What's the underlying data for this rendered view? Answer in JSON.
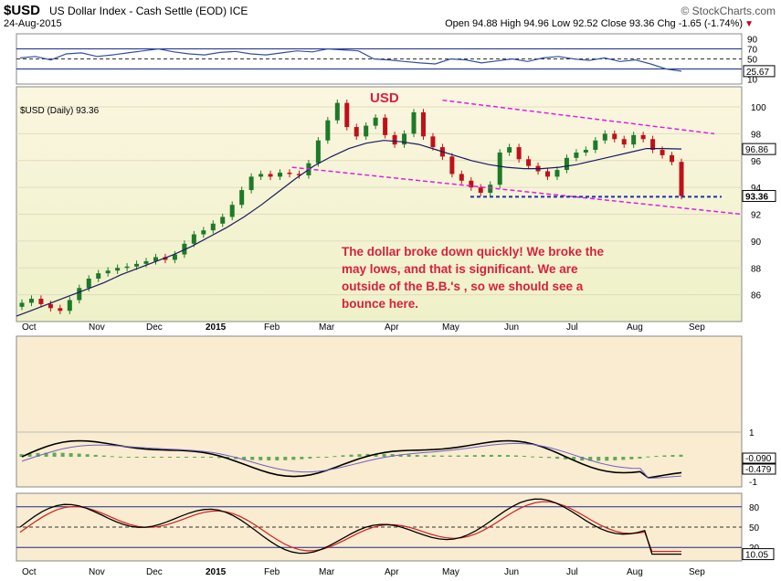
{
  "header": {
    "symbol": "$USD",
    "description": "US Dollar Index - Cash Settle (EOD) ICE",
    "date": "24-Aug-2015",
    "brand": "© StockCharts.com",
    "ohlc_text": "Open 94.88  High 94.96  Low 92.52  Close 93.36  Chg -1.65 (-1.74%)"
  },
  "annotations": {
    "usd_label": "USD",
    "note": "The dollar broke down quickly! We broke the may lows, and that is significant.  We are outside of the B.B.'s , so we should see a bounce here."
  },
  "colors": {
    "price_panel_bg": "#f7f0d2",
    "indicator_bg": "#f9ecd0",
    "trendline": "#e020e0",
    "support": "#2030b0",
    "note": "#d8213f",
    "up": "#1d7a28",
    "down": "#c0101a",
    "ma": "#1a1a60"
  },
  "chart_data": [
    {
      "type": "line",
      "panel": "RSI",
      "yticks": [
        "90",
        "70",
        "50",
        "30",
        "10"
      ],
      "last_value_label": "25.67",
      "overbought": 70,
      "oversold": 30,
      "values": [
        52,
        55,
        48,
        60,
        62,
        55,
        58,
        62,
        66,
        70,
        64,
        60,
        58,
        63,
        65,
        60,
        58,
        62,
        66,
        64,
        70,
        68,
        66,
        50,
        48,
        45,
        42,
        40,
        50,
        48,
        42,
        46,
        50,
        45,
        52,
        55,
        50,
        47,
        52,
        45,
        48,
        40,
        30,
        25.67
      ]
    },
    {
      "type": "candlestick",
      "panel": "price",
      "title": "$USD (Daily) 93.36",
      "x_labels": [
        "Oct",
        "Nov",
        "Dec",
        "2015",
        "Feb",
        "Mar",
        "Apr",
        "May",
        "Jun",
        "Jul",
        "Aug",
        "Sep"
      ],
      "yticks": [
        "100",
        "98",
        "96",
        "94",
        "92",
        "90",
        "88",
        "86"
      ],
      "ylim": [
        84,
        101.5
      ],
      "last_price_label": "93.36",
      "ma_label": "96.86",
      "close": [
        85.4,
        85.7,
        85.3,
        85.0,
        84.8,
        85.6,
        86.5,
        87.2,
        87.6,
        87.8,
        88.0,
        88.1,
        88.3,
        88.5,
        88.8,
        88.6,
        89.0,
        89.8,
        90.5,
        90.8,
        91.3,
        91.8,
        92.7,
        93.8,
        94.8,
        95.0,
        94.8,
        95.1,
        95.0,
        94.9,
        95.8,
        97.5,
        99.0,
        100.3,
        98.5,
        97.8,
        98.6,
        99.2,
        97.9,
        97.2,
        98.0,
        99.6,
        97.8,
        97.0,
        96.3,
        95.0,
        94.5,
        94.0,
        93.6,
        94.2,
        96.6,
        97.0,
        96.1,
        95.6,
        95.2,
        94.8,
        95.3,
        96.2,
        96.6,
        96.8,
        97.5,
        98.0,
        97.6,
        97.2,
        97.9,
        97.6,
        96.8,
        96.4,
        95.9,
        93.36
      ],
      "ma": [
        84.4,
        84.9,
        85.4,
        85.9,
        86.4,
        86.9,
        87.5,
        88.0,
        88.5,
        89.0,
        89.6,
        90.3,
        91.0,
        91.8,
        92.7,
        93.7,
        94.7,
        95.6,
        96.3,
        96.9,
        97.3,
        97.5,
        97.4,
        97.2,
        96.8,
        96.4,
        96.0,
        95.7,
        95.5,
        95.4,
        95.4,
        95.5,
        95.7,
        96.0,
        96.3,
        96.6,
        96.9,
        96.9,
        96.86
      ],
      "trendlines": [
        {
          "name": "upper",
          "from": [
            60,
            100.5
          ],
          "to": [
            100,
            98.0
          ]
        },
        {
          "name": "lower",
          "from": [
            38,
            95.5
          ],
          "to": [
            100,
            92.0
          ]
        },
        {
          "name": "support",
          "value": 93.3
        }
      ]
    },
    {
      "type": "line",
      "panel": "MACD",
      "yticks": [
        "1",
        "0",
        "-1"
      ],
      "macd_label": "-0.090",
      "signal_label": "-0.479"
    },
    {
      "type": "line",
      "panel": "Stochastics",
      "yticks": [
        "80",
        "50",
        "20"
      ],
      "last_value_label": "10.05"
    }
  ]
}
